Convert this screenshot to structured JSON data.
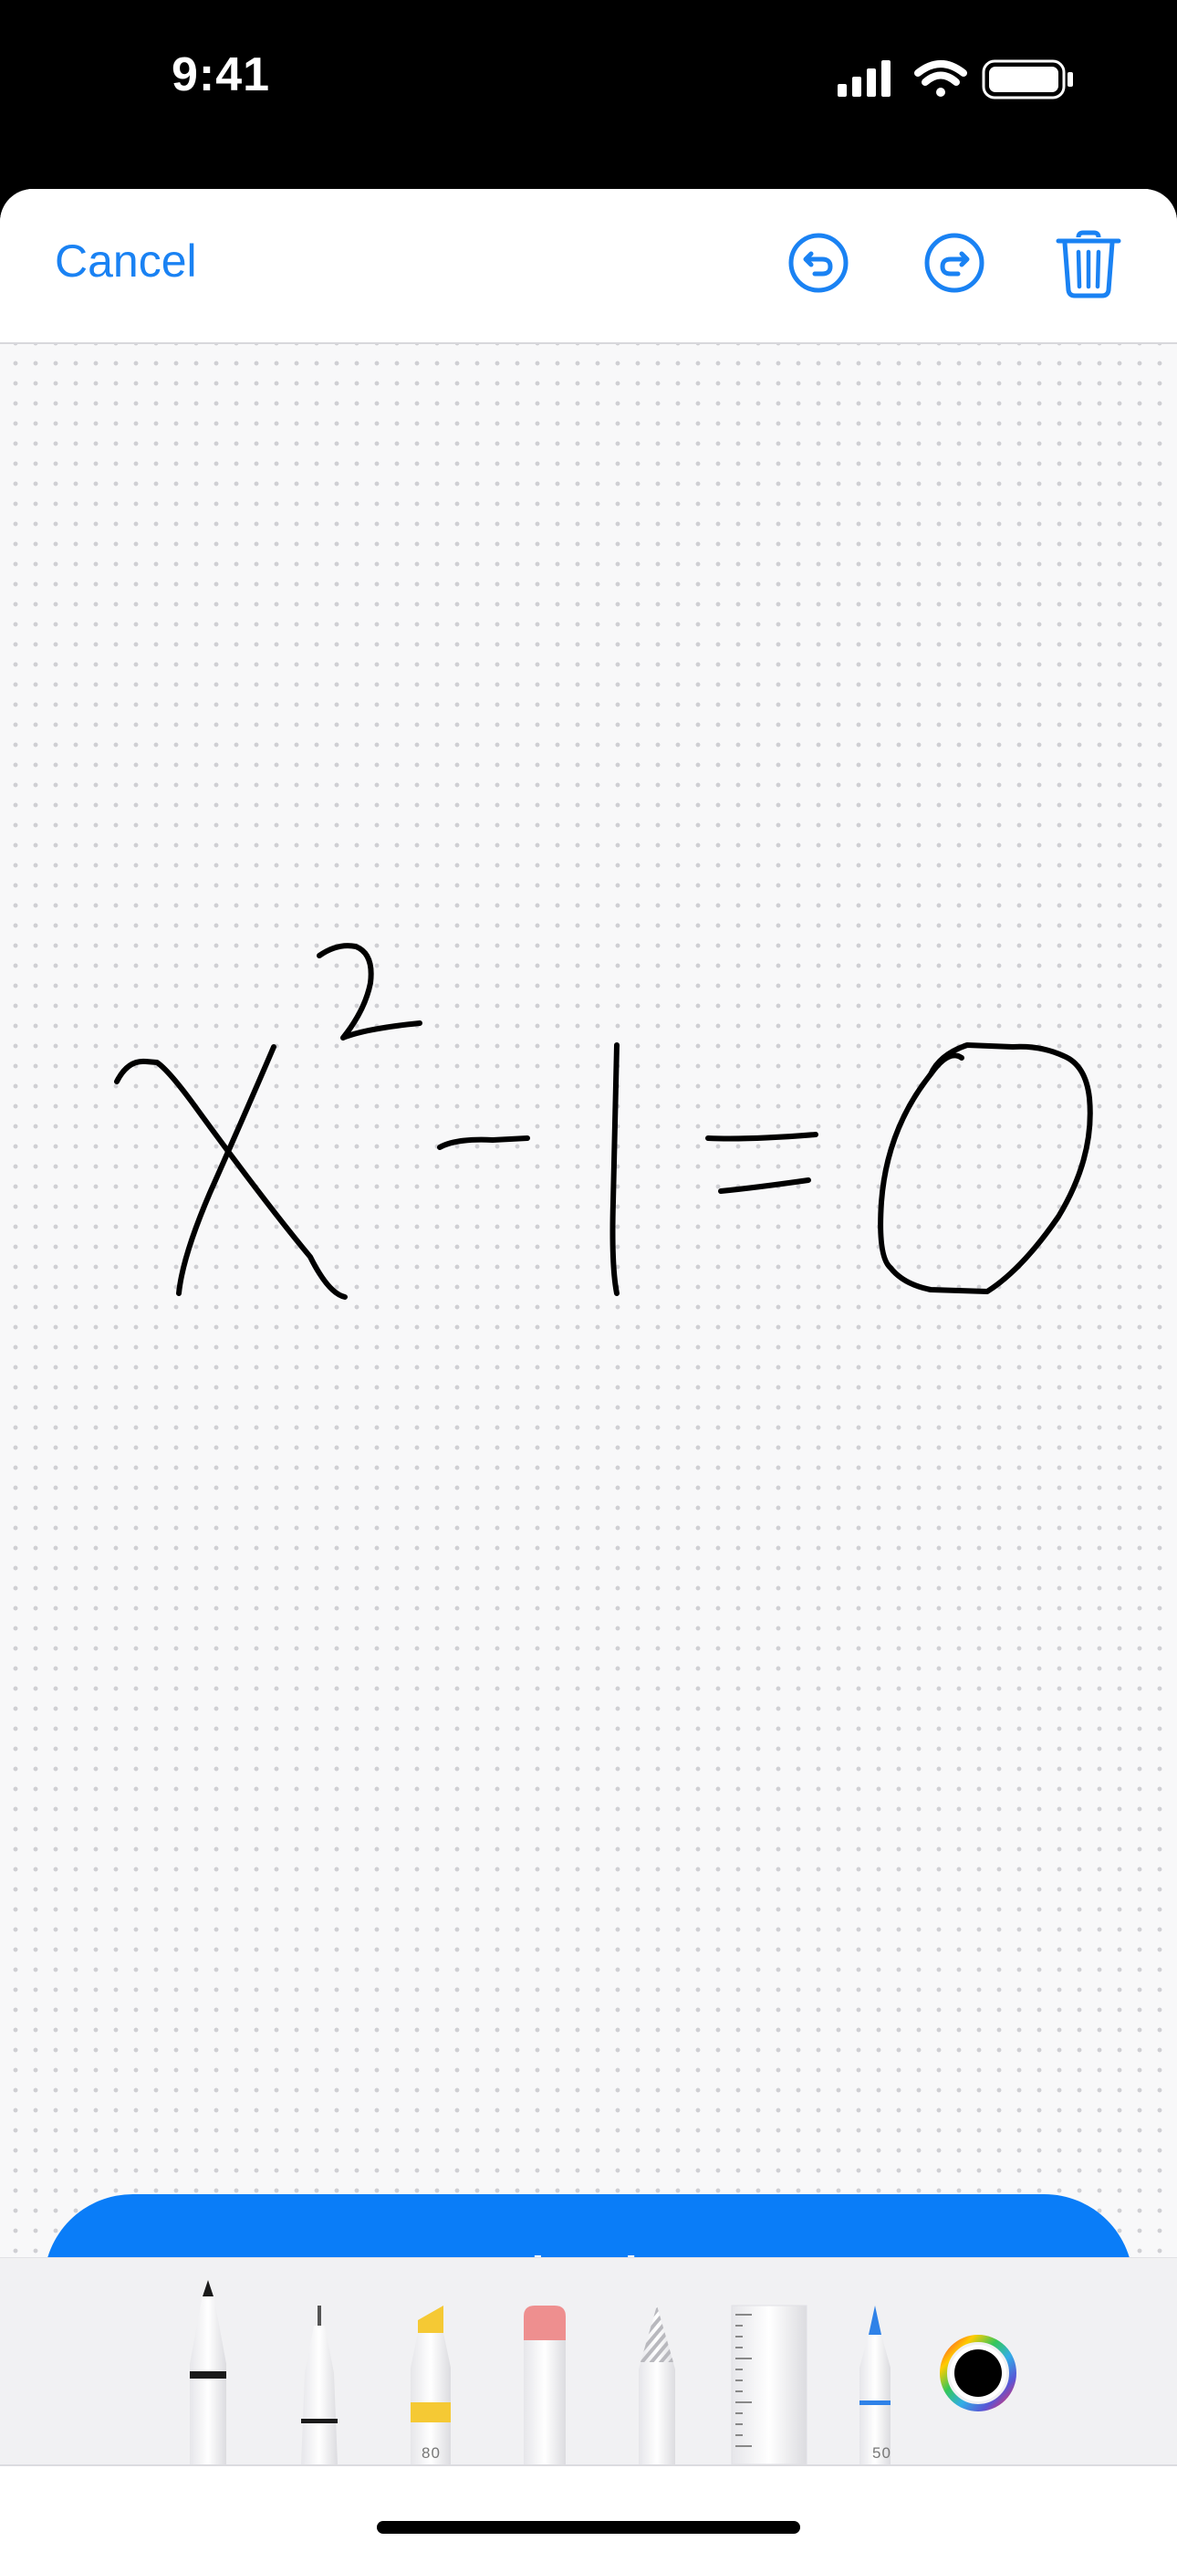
{
  "status_bar": {
    "time": "9:41",
    "icons": [
      "cellular-signal-icon",
      "wifi-icon",
      "battery-icon"
    ]
  },
  "nav": {
    "cancel_label": "Cancel",
    "icons": [
      "undo-icon",
      "redo-icon",
      "trash-icon"
    ]
  },
  "canvas": {
    "handwritten_expression": "x^2 - 1 = 0"
  },
  "calculate_button": {
    "label": "Calculate"
  },
  "tools": [
    {
      "name": "pen",
      "icon": "pen-tool-icon"
    },
    {
      "name": "fineliner",
      "icon": "fineliner-tool-icon"
    },
    {
      "name": "highlighter",
      "icon": "highlighter-tool-icon",
      "number": "80",
      "color": "#f5c934"
    },
    {
      "name": "eraser",
      "icon": "eraser-tool-icon",
      "color": "#ee8f8f"
    },
    {
      "name": "lasso",
      "icon": "lasso-tool-icon"
    },
    {
      "name": "ruler",
      "icon": "ruler-tool-icon"
    },
    {
      "name": "crayon",
      "icon": "blue-pen-tool-icon",
      "number": "50",
      "color": "#2f82e8"
    },
    {
      "name": "color-picker",
      "icon": "color-picker-icon",
      "color": "#000000"
    }
  ],
  "colors": {
    "accent": "#1a82f3",
    "button": "#0a7df8"
  }
}
